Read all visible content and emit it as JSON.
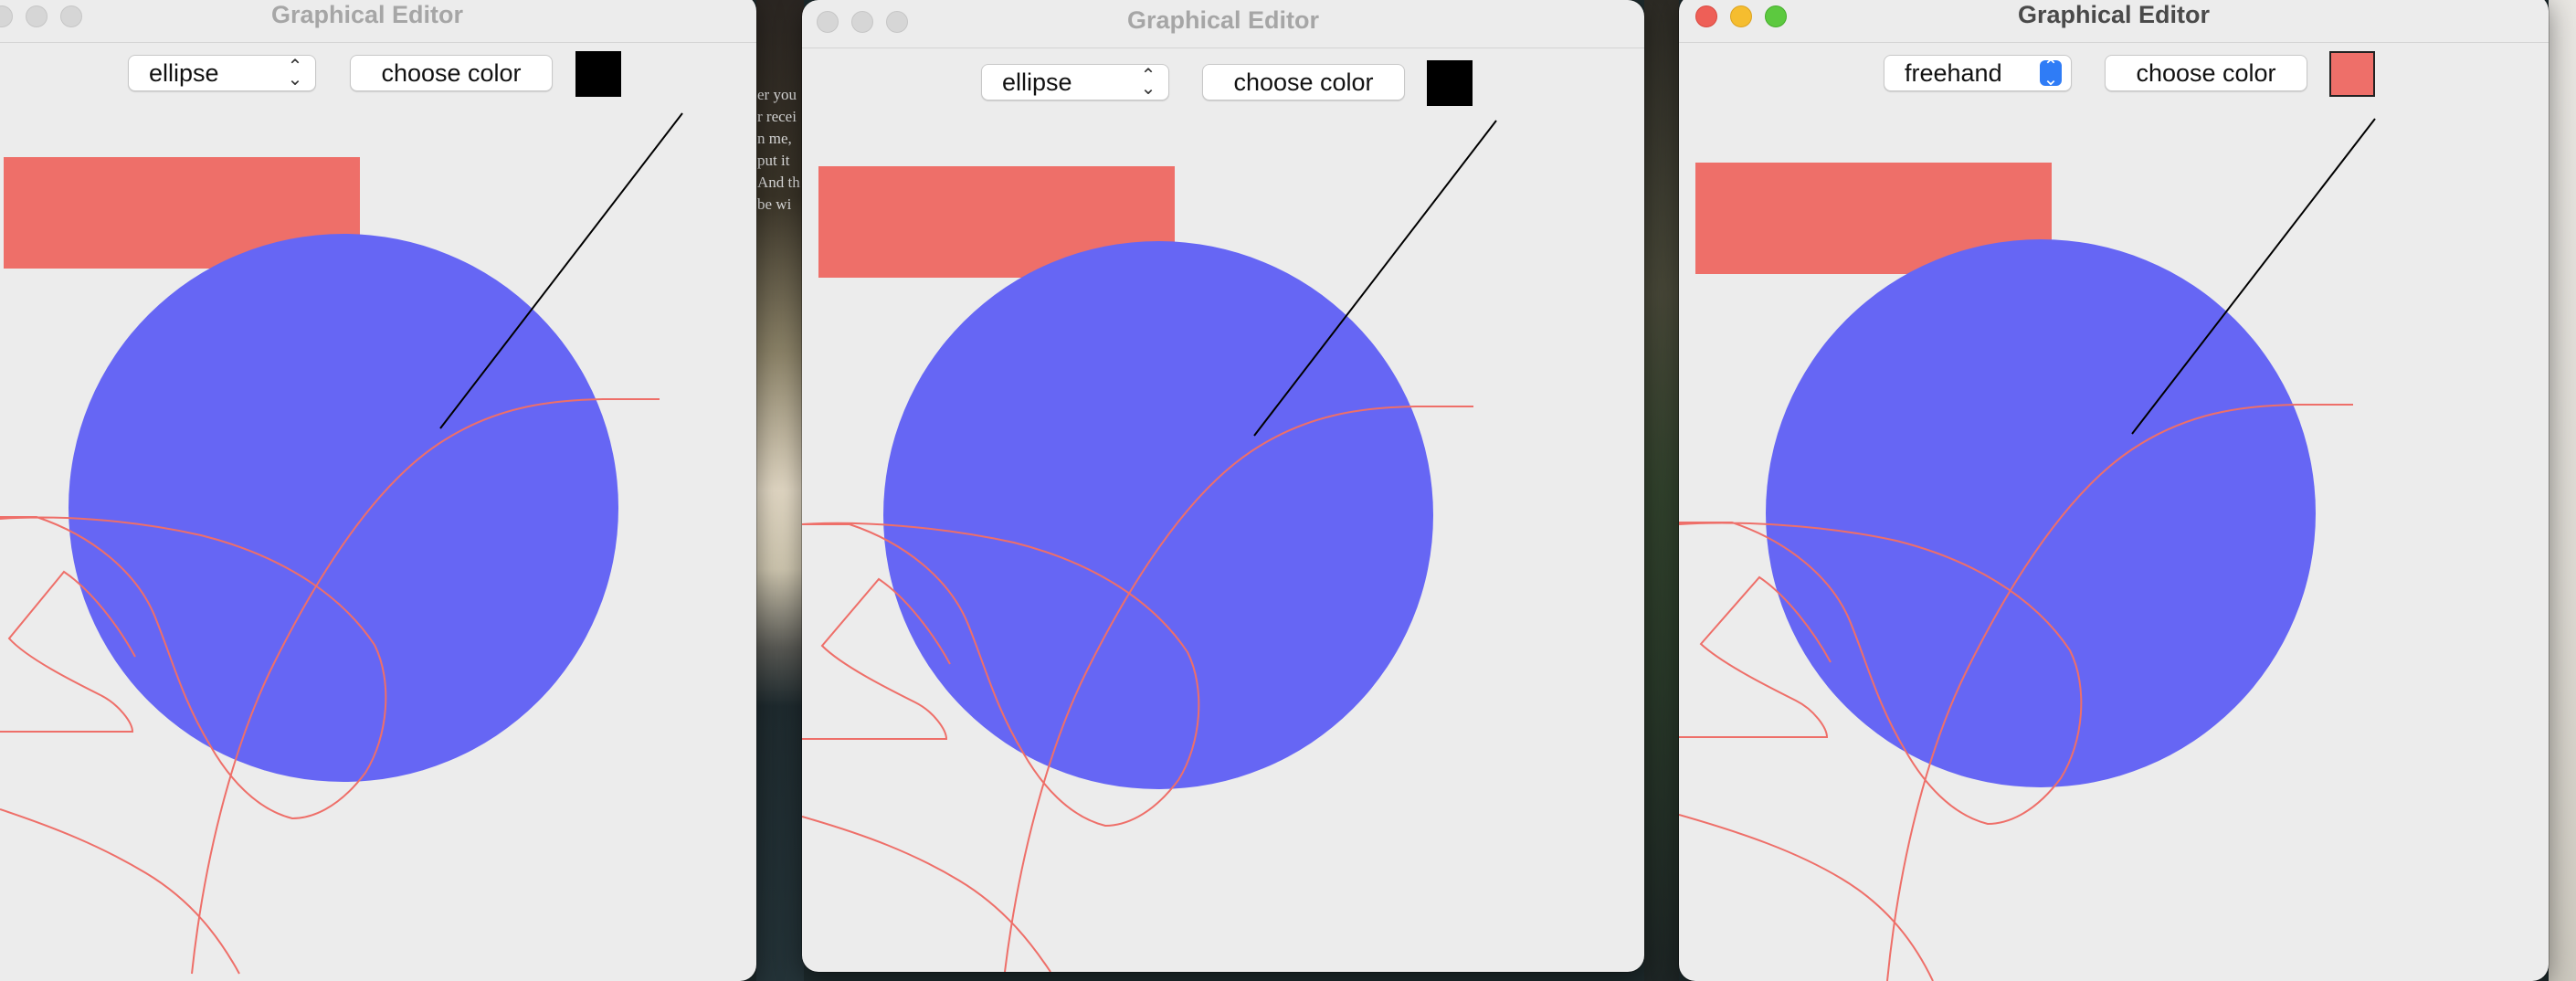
{
  "windows": [
    {
      "title": "Graphical Editor",
      "active": false,
      "shape_select": {
        "value": "ellipse"
      },
      "choose_color_label": "choose color",
      "current_color": "#000000"
    },
    {
      "title": "Graphical Editor",
      "active": false,
      "shape_select": {
        "value": "ellipse"
      },
      "choose_color_label": "choose color",
      "current_color": "#000000"
    },
    {
      "title": "Graphical Editor",
      "active": true,
      "shape_select": {
        "value": "freehand"
      },
      "choose_color_label": "choose color",
      "current_color": "#ee6f69"
    }
  ],
  "drawing": {
    "rectangle_color": "#ee6f69",
    "ellipse_color": "#6666f4",
    "line_color": "#000000",
    "freehand_color": "#ee6f69"
  },
  "desktop": {
    "partial_text": [
      "er you",
      "r recei",
      "n me,",
      "put it",
      "And th",
      "be wi"
    ]
  }
}
